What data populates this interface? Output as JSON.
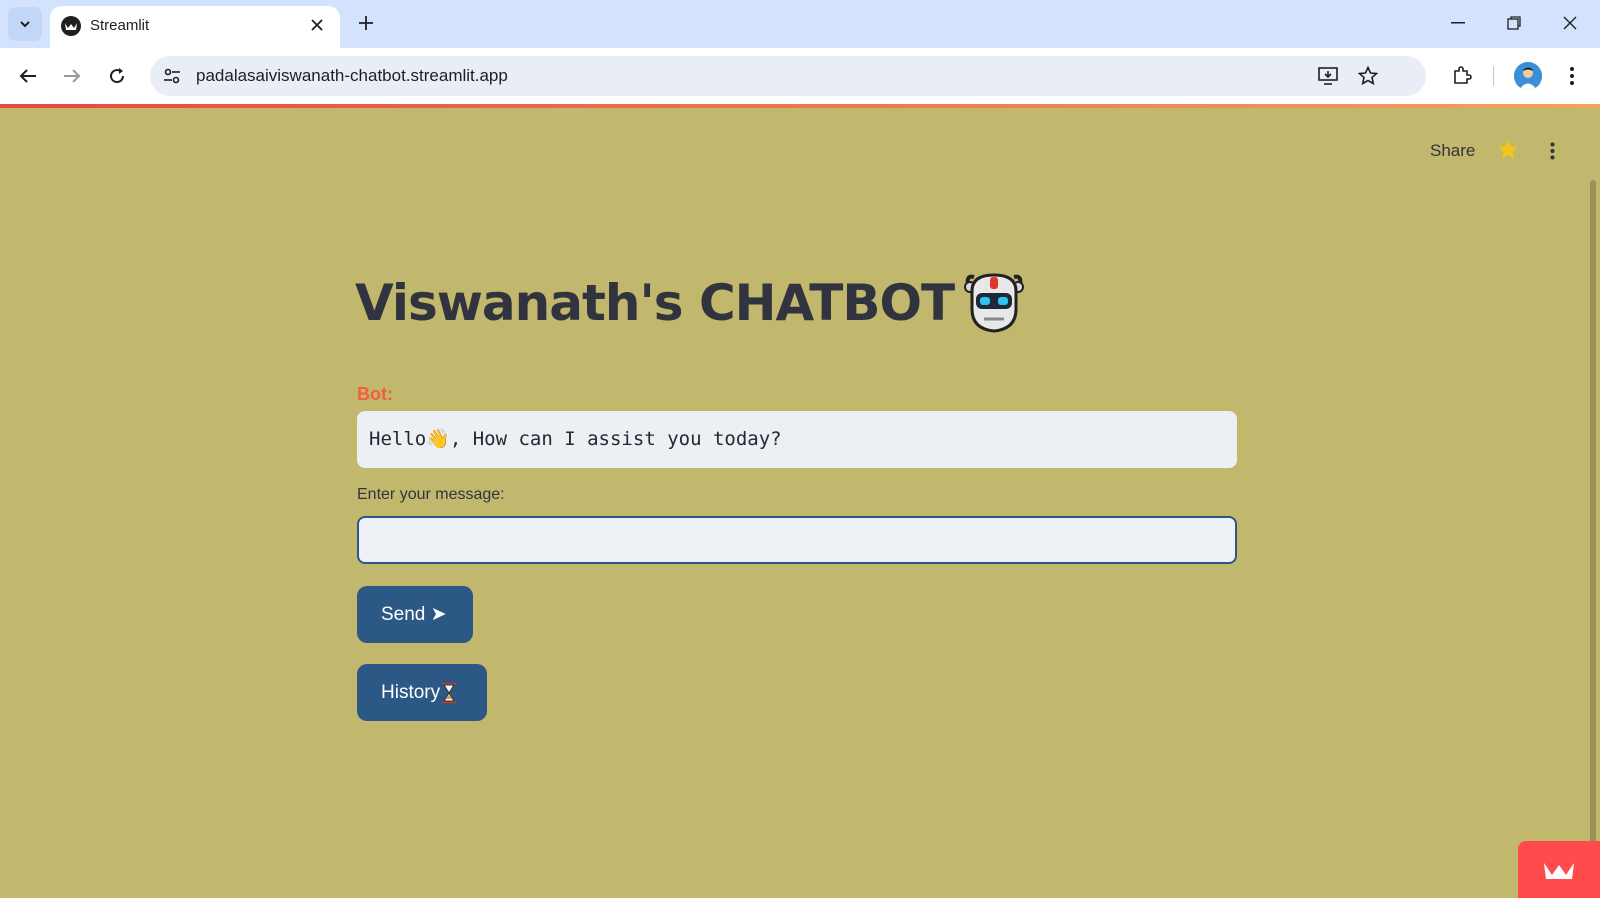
{
  "browser": {
    "tab_title": "Streamlit",
    "url": "padalasaiviswanath-chatbot.streamlit.app"
  },
  "app": {
    "header": {
      "share_label": "Share"
    },
    "title": "Viswanath's CHATBOT",
    "bot_label": "Bot:",
    "bot_message": "Hello👋, How can I assist you today?",
    "input": {
      "label": "Enter your message:",
      "value": "",
      "placeholder": ""
    },
    "send_button": "Send ➤",
    "history_button": "History"
  },
  "colors": {
    "background": "#c1b76d",
    "button": "#2c5886",
    "bot_label": "#f0603a",
    "badge": "#ff4b4b"
  },
  "icons": [
    "chevron-down-icon",
    "streamlit-favicon-icon",
    "close-icon",
    "plus-icon",
    "minimize-icon",
    "restore-icon",
    "back-icon",
    "forward-icon",
    "reload-icon",
    "site-info-icon",
    "install-app-icon",
    "bookmark-star-icon",
    "extensions-icon",
    "kebab-menu-icon",
    "star-icon",
    "robot-icon",
    "hourglass-icon",
    "streamlit-crown-icon"
  ]
}
